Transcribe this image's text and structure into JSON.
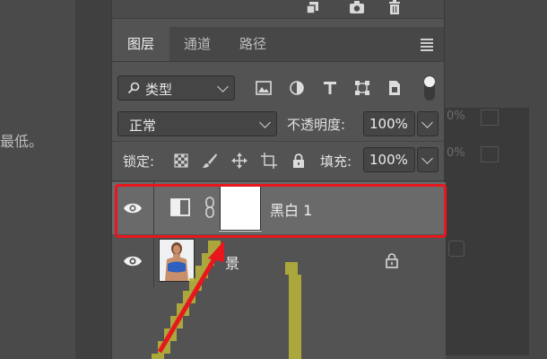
{
  "background": {
    "left_text": "最低。",
    "right_opacity_1": "0%",
    "right_opacity_2": "0%"
  },
  "toolbar_icons": [
    "new-layer-icon",
    "camera-icon",
    "trash-icon"
  ],
  "tabs": [
    {
      "label": "图层",
      "active": true
    },
    {
      "label": "通道",
      "active": false
    },
    {
      "label": "路径",
      "active": false
    }
  ],
  "filter": {
    "kind_label": "类型"
  },
  "blend": {
    "mode": "正常",
    "opacity_label": "不透明度:",
    "opacity_value": "100%"
  },
  "lock": {
    "label": "锁定:",
    "fill_label": "填充:",
    "fill_value": "100%"
  },
  "layers": [
    {
      "name": "黑白 1",
      "selected": true
    },
    {
      "name": "景",
      "selected": false
    }
  ],
  "colors": {
    "highlight": "#e8171d",
    "panel": "#535353",
    "selected_row": "#6a6a6a"
  }
}
